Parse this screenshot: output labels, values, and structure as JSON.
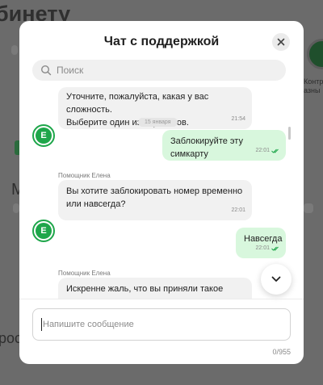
{
  "background": {
    "page_title": "бинету",
    "partial_heading": "М",
    "partial_bottom_text": "рос",
    "side_label_top": "Контр",
    "side_label_bottom": "азны"
  },
  "chat": {
    "title": "Чат с поддержкой",
    "search_placeholder": "Поиск",
    "date_separator": "15 января",
    "messages": [
      {
        "direction": "in",
        "text_line1": "Уточните, пожалуйста, какая у вас сложность.",
        "text_line2": "Выберите один из вариантов.",
        "time": "21:54"
      },
      {
        "direction": "out",
        "text": "Заблокируйте эту симкарту",
        "time": "22:01"
      },
      {
        "direction": "in",
        "sender": "Помощник Елена",
        "text_line1": "Вы хотите заблокировать номер временно",
        "text_line2": "или навсегда?",
        "time": "22:01"
      },
      {
        "direction": "out",
        "text": "Навсегда",
        "time": "22:01"
      },
      {
        "direction": "in",
        "sender": "Помощник Елена",
        "text_line1": "Искренне жаль, что вы приняли такое"
      }
    ],
    "avatar_letter": "E",
    "input_placeholder": "Напишите сообщение",
    "char_counter": "0/955"
  },
  "colors": {
    "brand_green": "#1ea64a",
    "outgoing_bubble": "#d8f7dd",
    "incoming_bubble": "#f1f1f1"
  },
  "icons": [
    "close-icon",
    "search-icon",
    "double-check-icon",
    "chevron-down-icon"
  ]
}
